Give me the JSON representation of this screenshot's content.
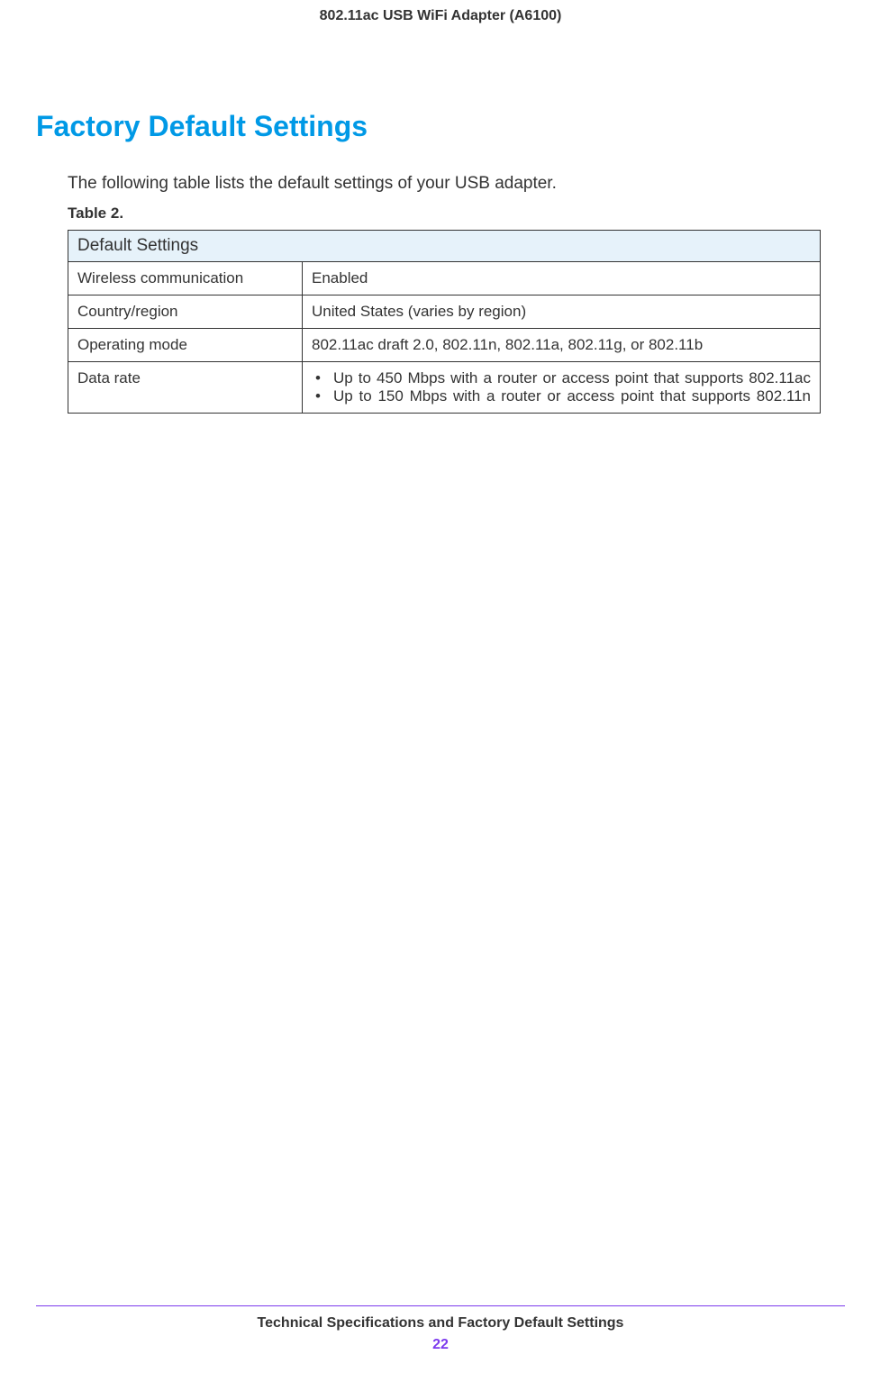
{
  "header": {
    "title": "802.11ac USB WiFi Adapter (A6100)"
  },
  "main": {
    "heading": "Factory Default Settings",
    "intro": "The following table lists the default settings of your USB adapter.",
    "table_label": "Table 2.",
    "table": {
      "header": "Default Settings",
      "rows": [
        {
          "label": "Wireless communication",
          "value": "Enabled"
        },
        {
          "label": "Country/region",
          "value": "United States (varies by region)"
        },
        {
          "label": "Operating mode",
          "value": "802.11ac draft 2.0, 802.11n, 802.11a, 802.11g, or 802.11b"
        }
      ],
      "data_rate_label": "Data rate",
      "data_rate_bullets": [
        "Up to 450 Mbps with a router or access point that supports 802.11ac",
        "Up to 150 Mbps with a router or access point that supports 802.11n"
      ]
    }
  },
  "footer": {
    "text": "Technical Specifications and Factory Default Settings",
    "page_number": "22"
  }
}
